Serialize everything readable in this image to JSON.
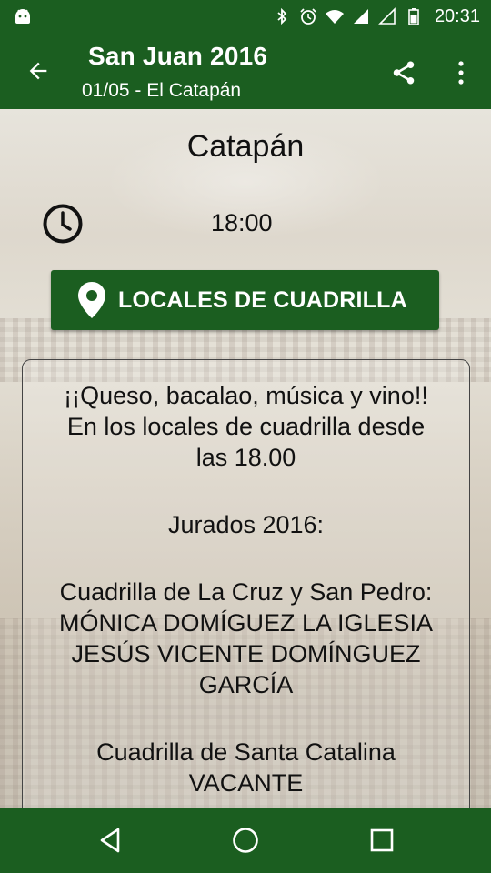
{
  "status_bar": {
    "time": "20:31",
    "icons": [
      "android-icon",
      "bluetooth-icon",
      "alarm-icon",
      "wifi-icon",
      "signal-icon",
      "signal-empty-icon",
      "battery-icon"
    ]
  },
  "app_bar": {
    "title": "San Juan 2016",
    "subtitle": "01/05 - El Catapán",
    "back_icon": "arrow-back-icon",
    "share_icon": "share-icon",
    "more_icon": "more-vert-icon",
    "color": "#1b5e20"
  },
  "event": {
    "place": "Catapán",
    "time": "18:00",
    "location_button": "LOCALES DE CUADRILLA",
    "description": {
      "p1": [
        "¡¡Queso, bacalao, música y vino!!",
        "En los locales de cuadrilla desde",
        "las 18.00"
      ],
      "p2": [
        "Jurados 2016:"
      ],
      "p3": [
        "Cuadrilla de La Cruz y San Pedro:",
        "MÓNICA DOMÍGUEZ LA IGLESIA",
        "JESÚS VICENTE DOMÍNGUEZ",
        "GARCÍA"
      ],
      "p4": [
        "Cuadrilla de Santa Catalina",
        "VACANTE"
      ]
    }
  },
  "nav_bar": {
    "icons": [
      "nav-back-icon",
      "nav-home-icon",
      "nav-recents-icon"
    ]
  }
}
